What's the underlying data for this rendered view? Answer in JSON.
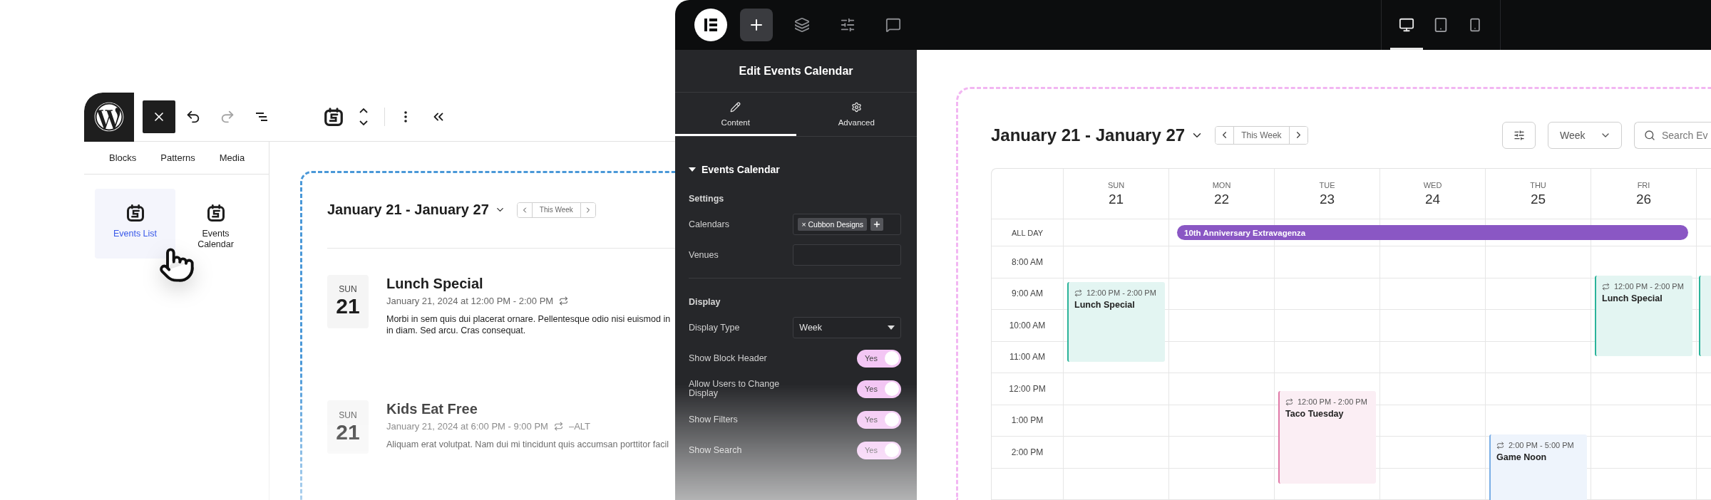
{
  "wp_editor": {
    "tools": [
      {
        "kind": "close",
        "disabled": false
      },
      {
        "kind": "undo",
        "disabled": false
      },
      {
        "kind": "redo",
        "disabled": true
      },
      {
        "kind": "list",
        "disabled": false
      },
      {
        "kind": "block",
        "disabled": false
      },
      {
        "kind": "mover",
        "disabled": false
      },
      {
        "kind": "more",
        "disabled": false
      },
      {
        "kind": "collapse",
        "disabled": false
      }
    ],
    "inserter_tabs": [
      "Blocks",
      "Patterns",
      "Media"
    ],
    "blocks": [
      {
        "label": "Events List",
        "selected": true
      },
      {
        "label": "Events Calendar",
        "selected": false
      }
    ],
    "preview": {
      "range_title": "January 21 - January 27",
      "nav_label": "This Week",
      "events": [
        {
          "weekday": "SUN",
          "day": "21",
          "title": "Lunch Special",
          "when": "January 21, 2024 at 12:00 PM - 2:00 PM",
          "description_lines": [
            "Morbi in sem quis dui placerat ornare. Pellentesque odio nisi euismod in",
            "in diam. Sed arcu. Cras consequat."
          ]
        },
        {
          "weekday": "SUN",
          "day": "21",
          "title": "Kids Eat Free",
          "when": "January 21, 2024 at 6:00 PM - 9:00 PM",
          "suffix": "–ALT",
          "description_lines": [
            "Aliquam erat volutpat. Nam dui mi tincidunt quis accumsan porttitor facil"
          ]
        }
      ]
    }
  },
  "elementor": {
    "top_tools": [
      {
        "kind": "add",
        "selected": true
      },
      {
        "kind": "layers",
        "selected": false
      },
      {
        "kind": "settings",
        "selected": false
      },
      {
        "kind": "comments",
        "selected": false
      }
    ],
    "device_modes": [
      {
        "kind": "desktop",
        "selected": true
      },
      {
        "kind": "tablet",
        "selected": false
      },
      {
        "kind": "mobile",
        "selected": false
      }
    ],
    "panel": {
      "title": "Edit Events Calendar",
      "tabs": [
        {
          "kind": "pencil",
          "label": "Content",
          "selected": true
        },
        {
          "kind": "gear",
          "label": "Advanced",
          "selected": false
        }
      ],
      "section": {
        "title": "Events Calendar",
        "expanded": true
      },
      "groups": [
        {
          "heading": "Settings",
          "fields": [
            {
              "kind": "tags",
              "label": "Calendars",
              "tags": [
                {
                  "remove_mark": "×",
                  "label": "Cubbon Designs"
                }
              ]
            },
            {
              "kind": "text",
              "label": "Venues"
            }
          ]
        },
        {
          "heading": "Display",
          "fields": [
            {
              "kind": "select",
              "label": "Display Type",
              "value": "Week"
            },
            {
              "kind": "toggle",
              "label": "Show Block Header",
              "value": "Yes",
              "on": true
            },
            {
              "kind": "toggle",
              "label": "Allow Users to Change Display",
              "value": "Yes",
              "on": true
            },
            {
              "kind": "toggle",
              "label": "Show Filters",
              "value": "Yes",
              "on": true
            },
            {
              "kind": "toggle",
              "label": "Show Search",
              "value": "Yes",
              "on": true
            }
          ]
        }
      ]
    },
    "calendar": {
      "range_title": "January 21 - January 27",
      "nav_label": "This Week",
      "view": "Week",
      "search_placeholder": "Search Ev",
      "all_day_label": "ALL DAY",
      "all_day_event": {
        "title": "10th Anniversary Extravagenza",
        "color": "#8a57c4"
      },
      "time_labels": [
        "8:00 AM",
        "9:00 AM",
        "10:00 AM",
        "11:00 AM",
        "12:00 PM",
        "1:00 PM",
        "2:00 PM"
      ],
      "days": [
        {
          "weekday": "SUN",
          "date": "21",
          "events": [
            {
              "time": "12:00 PM - 2:00 PM",
              "title": "Lunch Special",
              "color": "#2bb39a"
            }
          ]
        },
        {
          "weekday": "MON",
          "date": "22"
        },
        {
          "weekday": "TUE",
          "date": "23",
          "events": [
            {
              "time": "12:00 PM - 2:00 PM",
              "title": "Taco Tuesday",
              "color": "#e07aa8"
            }
          ]
        },
        {
          "weekday": "WED",
          "date": "24"
        },
        {
          "weekday": "THU",
          "date": "25",
          "events": [
            {
              "time": "2:00 PM - 5:00 PM",
              "title": "Game Noon",
              "color": "#7aaee6"
            }
          ]
        },
        {
          "weekday": "FRI",
          "date": "26",
          "events": [
            {
              "time": "12:00 PM - 2:00 PM",
              "title": "Lunch Special",
              "color": "#2bb39a"
            }
          ]
        },
        {
          "events": [
            {
              "color": "#2bb39a"
            }
          ]
        }
      ]
    }
  }
}
